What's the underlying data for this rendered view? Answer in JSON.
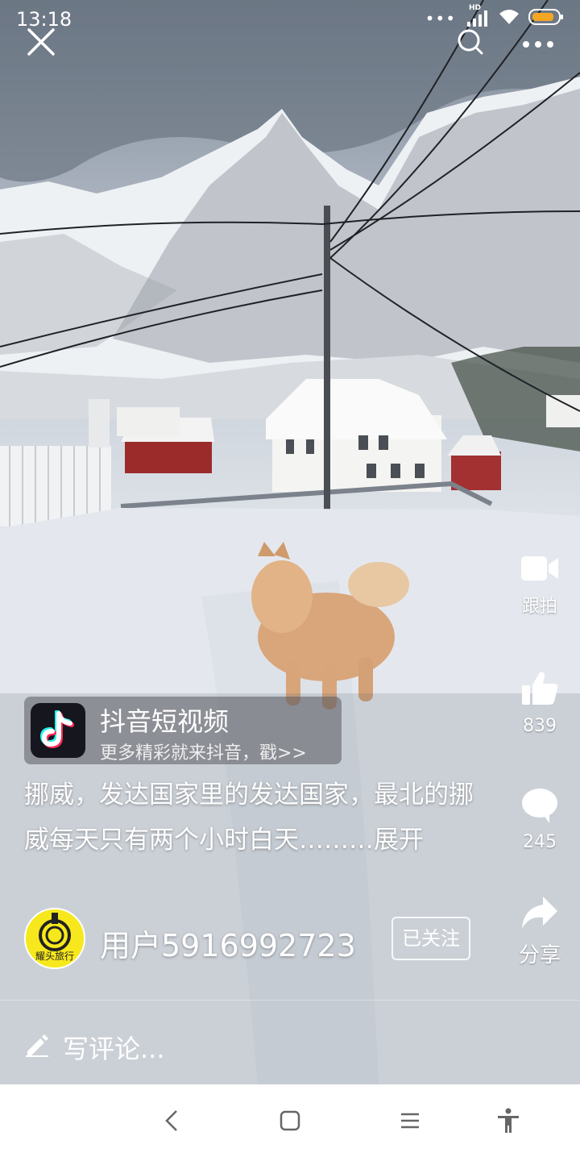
{
  "status_bar": {
    "time": "13:18",
    "hd_label": "HD",
    "battery_color": "#f5a623"
  },
  "top_bar": {
    "close_icon": "close-icon",
    "search_icon": "search-icon",
    "more_icon": "more-icon"
  },
  "actions": {
    "duet_label": "跟拍",
    "like_count": "839",
    "comment_count": "245",
    "share_label": "分享"
  },
  "promo": {
    "title": "抖音短视频",
    "subtitle": "更多精彩就来抖音，戳>>"
  },
  "caption": {
    "text": "挪威，发达国家里的发达国家，最北的挪威每天只有两个小时白天………",
    "expand_label": "展开"
  },
  "author": {
    "avatar_label": "耀头旅行",
    "username": "用户5916992723",
    "follow_label": "已关注"
  },
  "comment_bar": {
    "placeholder": "写评论..."
  },
  "colors": {
    "accent_yellow": "#f6e81c",
    "tiktok_cyan": "#25f4ee",
    "tiktok_red": "#fe2c55"
  }
}
